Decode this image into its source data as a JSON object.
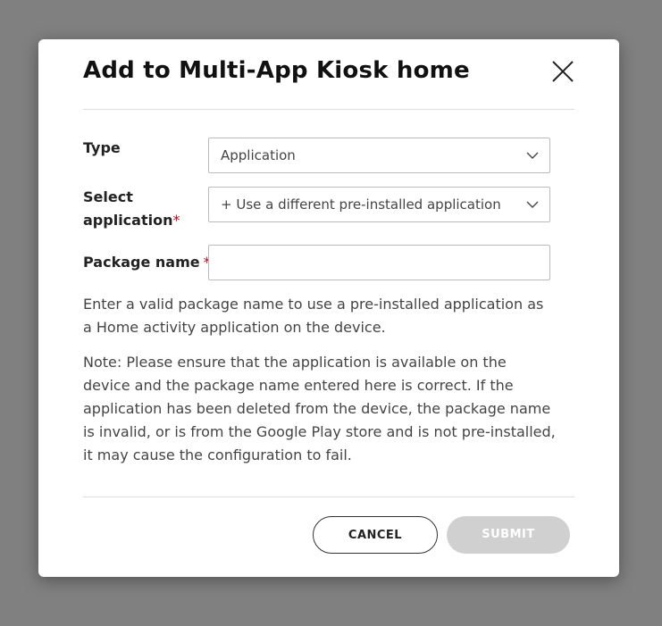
{
  "dialog": {
    "title": "Add to Multi-App Kiosk home"
  },
  "form": {
    "type_label": "Type",
    "type_value": "Application",
    "select_app_label_line1": "Select",
    "select_app_label_line2": "application",
    "select_app_required": "*",
    "select_app_value": "+ Use a different pre-installed application",
    "package_label": "Package name",
    "package_required": "*",
    "package_value": "",
    "package_placeholder": ""
  },
  "help": {
    "description": "Enter a valid package name to use a pre-installed application as a Home activity application on the device.",
    "note": "Note: Please ensure that the application is available on the device and the package name entered here is correct. If the application has been deleted from the device, the package name is invalid, or is from the Google Play store and is not pre-installed, it may cause the configuration to fail."
  },
  "buttons": {
    "cancel": "CANCEL",
    "submit": "SUBMIT"
  },
  "colors": {
    "overlay": "#808080",
    "required": "#d0021b",
    "submit_disabled": "#d0d0d0"
  },
  "icons": {
    "close": "close-icon",
    "chevron": "chevron-down-icon"
  }
}
